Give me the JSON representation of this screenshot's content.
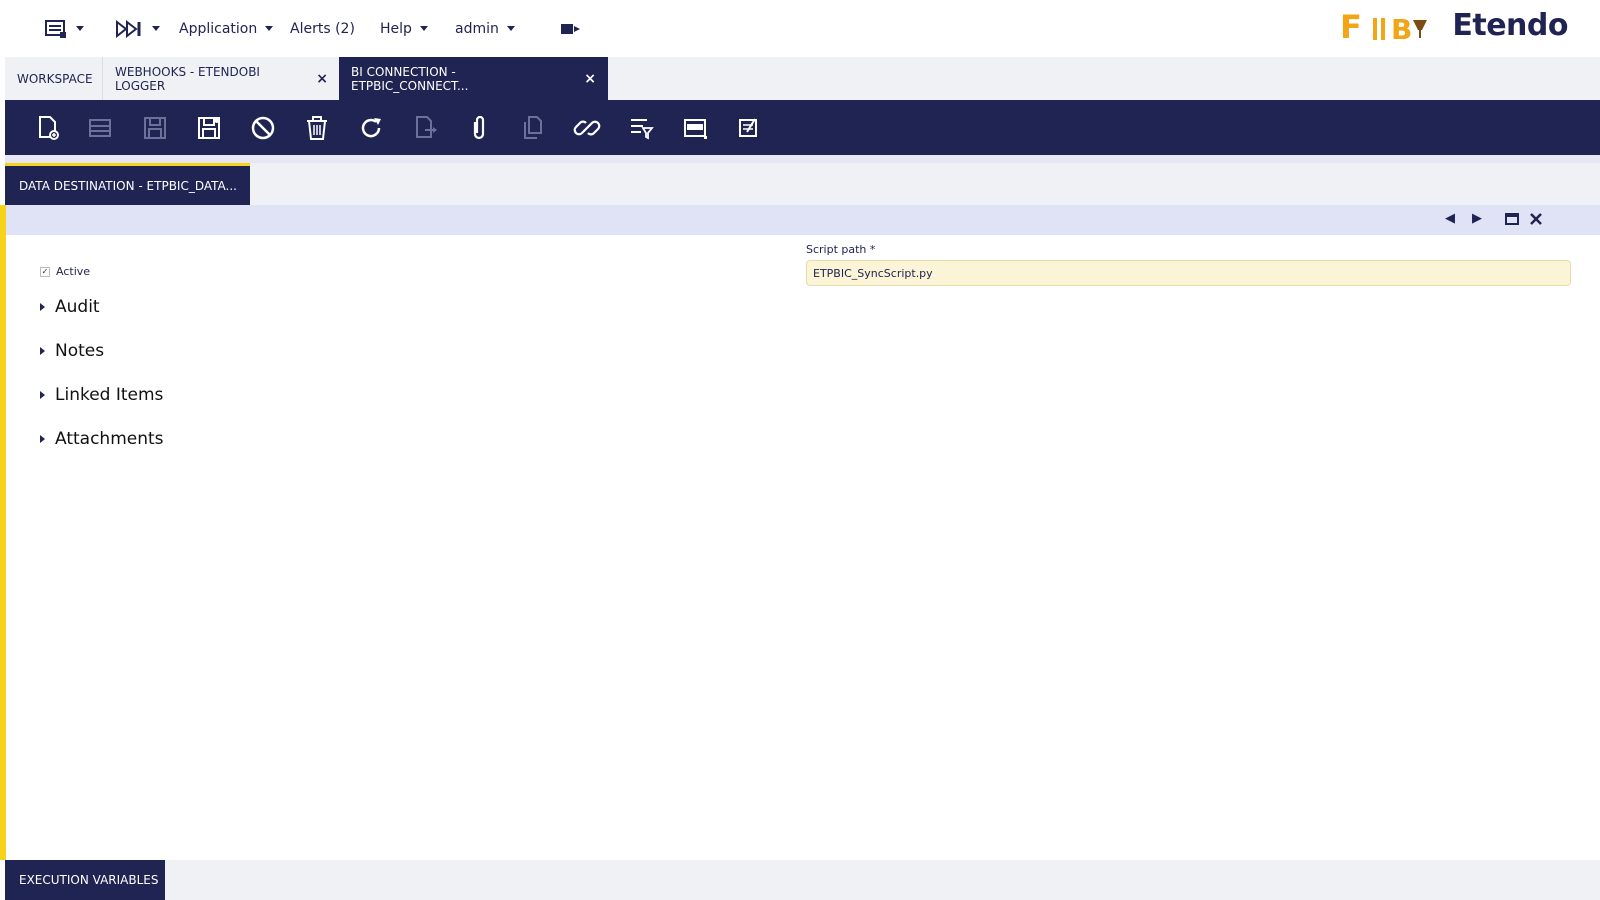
{
  "header": {
    "menu_application": "Application",
    "menu_alerts": "Alerts (2)",
    "menu_help": "Help",
    "menu_user": "admin",
    "brand_fiby": "F",
    "brand_name": "Etendo"
  },
  "tabs": [
    {
      "label": "WORKSPACE"
    },
    {
      "label": "WEBHOOKS - ETENDOBI LOGGER",
      "close": "×"
    },
    {
      "label": "BI CONNECTION - ETPBIC_CONNECT...",
      "close": "×"
    }
  ],
  "toolbar": {
    "icons": [
      "new-document-icon",
      "new-row-icon",
      "save-icon",
      "save-close-icon",
      "cancel-icon",
      "delete-icon",
      "refresh-icon",
      "export-icon",
      "attach-icon",
      "clone-icon",
      "link-icon",
      "filter-icon",
      "grid-view-icon",
      "notes-icon"
    ]
  },
  "subtab": {
    "label": "DATA DESTINATION - ETPBIC_DATA..."
  },
  "form": {
    "active_label": "Active",
    "active_checked": true,
    "script_path_label": "Script path *",
    "script_path_value": "ETPBIC_SyncScript.py",
    "sections": [
      "Audit",
      "Notes",
      "Linked Items",
      "Attachments"
    ]
  },
  "bottom": {
    "label": "EXECUTION VARIABLES"
  },
  "colors": {
    "navy": "#202452",
    "yellow": "#f7d21a",
    "input_bg": "#fbf4d7"
  }
}
